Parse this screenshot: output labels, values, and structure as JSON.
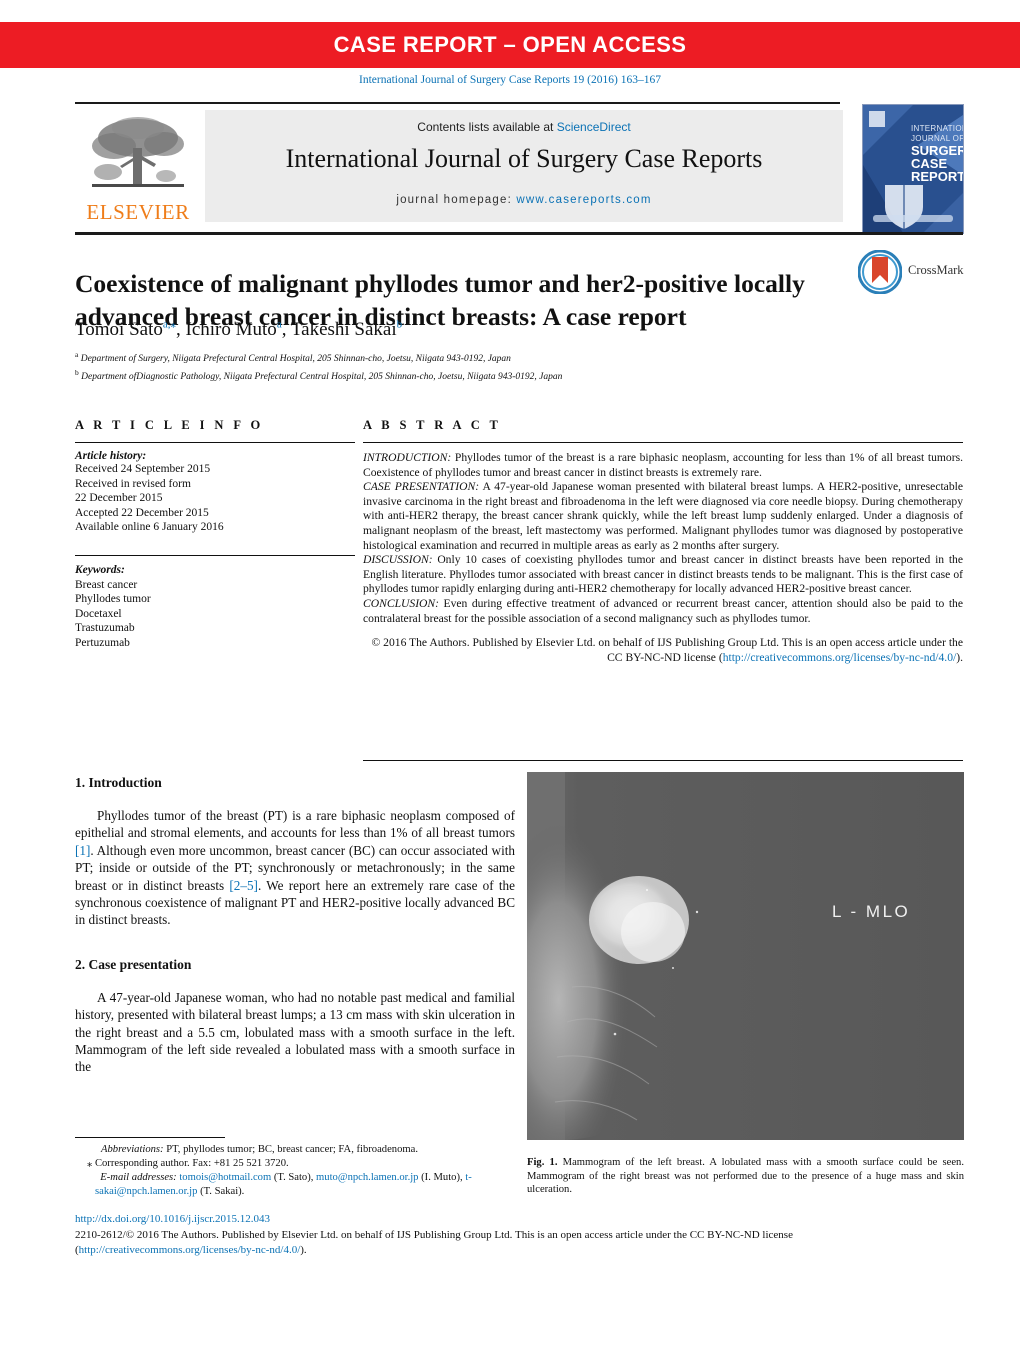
{
  "banner": {
    "text": "CASE REPORT – OPEN ACCESS"
  },
  "citation": "International Journal of Surgery Case Reports 19 (2016) 163–167",
  "header": {
    "publisher_logo_text": "ELSEVIER",
    "contents_prefix": "Contents lists available at ",
    "contents_link": "ScienceDirect",
    "journal_title": "International Journal of Surgery Case Reports",
    "homepage_prefix": "journal homepage: ",
    "homepage_url": "www.casereports.com",
    "cover_lines": [
      "INTERNATIONAL",
      "JOURNAL OF",
      "SURGERY",
      "CASE",
      "REPORTS"
    ]
  },
  "article": {
    "title": "Coexistence of malignant phyllodes tumor and her2-positive locally advanced breast cancer in distinct breasts: A case report",
    "crossmark_label": "CrossMark",
    "authors_html": "Tomoi Sato<sup>a,⁎</sup>, Ichiro Muto<sup>a</sup>, Takeshi Sakai<sup>b</sup>",
    "affiliations": [
      {
        "marker": "a",
        "text": "Department of Surgery, Niigata Prefectural Central Hospital, 205 Shinnan-cho, Joetsu, Niigata 943-0192, Japan"
      },
      {
        "marker": "b",
        "text": "Department ofDiagnostic Pathology, Niigata Prefectural Central Hospital, 205 Shinnan-cho, Joetsu, Niigata 943-0192, Japan"
      }
    ]
  },
  "info": {
    "heading": "A R T I C L E    I N F O",
    "history_label": "Article history:",
    "history": [
      "Received 24 September 2015",
      "Received in revised form",
      "22 December 2015",
      "Accepted 22 December 2015",
      "Available online 6 January 2016"
    ],
    "keywords_label": "Keywords:",
    "keywords": [
      "Breast cancer",
      "Phyllodes tumor",
      "Docetaxel",
      "Trastuzumab",
      "Pertuzumab"
    ]
  },
  "abstract": {
    "heading": "A B S T R A C T",
    "sections": [
      {
        "label": "INTRODUCTION:",
        "text": " Phyllodes tumor of the breast is a rare biphasic neoplasm, accounting for less than 1% of all breast tumors. Coexistence of phyllodes tumor and breast cancer in distinct breasts is extremely rare."
      },
      {
        "label": "CASE PRESENTATION:",
        "text": " A 47-year-old Japanese woman presented with bilateral breast lumps. A HER2-positive, unresectable invasive carcinoma in the right breast and fibroadenoma in the left were diagnosed via core needle biopsy. During chemotherapy with anti-HER2 therapy, the breast cancer shrank quickly, while the left breast lump suddenly enlarged. Under a diagnosis of malignant neoplasm of the breast, left mastectomy was performed. Malignant phyllodes tumor was diagnosed by postoperative histological examination and recurred in multiple areas as early as 2 months after surgery."
      },
      {
        "label": "DISCUSSION:",
        "text": " Only 10 cases of coexisting phyllodes tumor and breast cancer in distinct breasts have been reported in the English literature. Phyllodes tumor associated with breast cancer in distinct breasts tends to be malignant. This is the first case of phyllodes tumor rapidly enlarging during anti-HER2 chemotherapy for locally advanced HER2-positive breast cancer."
      },
      {
        "label": "CONCLUSION:",
        "text": " Even during effective treatment of advanced or recurrent breast cancer, attention should also be paid to the contralateral breast for the possible association of a second malignancy such as phyllodes tumor."
      }
    ],
    "copyright_prefix": "© 2016 The Authors. Published by Elsevier Ltd. on behalf of IJS Publishing Group Ltd. This is an open access article under the CC BY-NC-ND license (",
    "copyright_link": "http://creativecommons.org/licenses/by-nc-nd/4.0/",
    "copyright_suffix": ")."
  },
  "body": {
    "section1_heading": "1.  Introduction",
    "section1_p1_a": "Phyllodes tumor of the breast (PT) is a rare biphasic neoplasm composed of epithelial and stromal elements, and accounts for less than 1% of all breast tumors ",
    "section1_ref1": "[1]",
    "section1_p1_b": ". Although even more uncommon, breast cancer (BC) can occur associated with PT; inside or outside of the PT; synchronously or metachronously; in the same breast or in distinct breasts ",
    "section1_ref2": "[2–5]",
    "section1_p1_c": ". We report here an extremely rare case of the synchronous coexistence of malignant PT and HER2-positive locally advanced BC in distinct breasts.",
    "section2_heading": "2.  Case presentation",
    "section2_p1": "A 47-year-old Japanese woman, who had no notable past medical and familial history, presented with bilateral breast lumps; a 13 cm mass with skin ulceration in the right breast and a 5.5 cm, lobulated mass with a smooth surface in the left. Mammogram of the left side revealed a lobulated mass with a smooth surface in the"
  },
  "footnotes": {
    "abbrev_label": "Abbreviations:",
    "abbrev_text": "  PT, phyllodes tumor; BC, breast cancer; FA, fibroadenoma.",
    "corresponding": "⁎ Corresponding author. Fax: +81 25 521 3720.",
    "email_label": "E-mail addresses:",
    "emails": [
      {
        "addr": "tomois@hotmail.com",
        "who": " (T. Sato), "
      },
      {
        "addr": "muto@npch.lamen.or.jp",
        "who": " (I. Muto), "
      },
      {
        "addr": "t-sakai@npch.lamen.or.jp",
        "who": " (T. Sakai)."
      }
    ]
  },
  "figure": {
    "image_label": "L - MLO",
    "caption_label": "Fig. 1.",
    "caption_text": "  Mammogram of the left breast. A lobulated mass with a smooth surface could be seen. Mammogram of the right breast was not performed due to the presence of a huge mass and skin ulceration."
  },
  "footer": {
    "doi": "http://dx.doi.org/10.1016/j.ijscr.2015.12.043",
    "issn_copyright": "2210-2612/© 2016 The Authors. Published by Elsevier Ltd. on behalf of IJS Publishing Group Ltd. This is an open access article under the CC BY-NC-ND license (",
    "license_link": "http://creativecommons.org/licenses/by-nc-nd/4.0/",
    "license_suffix": ")."
  },
  "colors": {
    "banner_red": "#ed1c24",
    "link_blue": "#0b72b5",
    "elsevier_orange": "#ef7d1a",
    "header_grey": "#ececec"
  }
}
